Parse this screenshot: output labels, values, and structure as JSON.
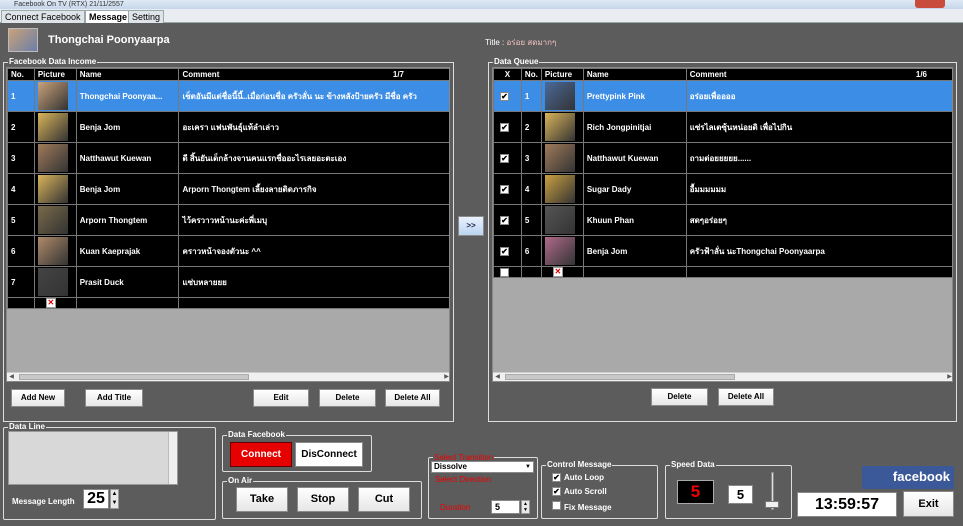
{
  "window": {
    "title": "Facebook On TV (RTX) 21/11/2557"
  },
  "tabs": [
    {
      "label": "Connect Facebook"
    },
    {
      "label": "Message"
    },
    {
      "label": "Setting"
    }
  ],
  "profile": {
    "name": "Thongchai Poonyaarpa"
  },
  "title_bar": {
    "label": "Title :",
    "value": "อร่อย สดมากๆ"
  },
  "income": {
    "legend": "Facebook Data Income",
    "headers": [
      "No.",
      "Picture",
      "Name",
      "Comment",
      "1/7"
    ],
    "rows": [
      {
        "no": "1",
        "name": "Thongchai Poonyaa...",
        "comment": "เซ็ตอันมีแต่ชื่อนี้นี้..เมื่อก่อนชื่อ ครัวลั่น นะ ข้างหลังป้ายครัว มีชื่อ ครัว",
        "selected": true
      },
      {
        "no": "2",
        "name": "Benja Jom",
        "comment": "อะเครา แฟนพันธุ์แท้ลำเล่าว"
      },
      {
        "no": "3",
        "name": "Natthawut Kuewan",
        "comment": "ดี สิ้นยันเด็กล้างจานคนแรกชื่ออะไรเลยอะตะเอง"
      },
      {
        "no": "4",
        "name": "Benja Jom",
        "comment": "Arporn Thongtem เลี้ยงลายติดภารกิจ"
      },
      {
        "no": "5",
        "name": "Arporn Thongtem",
        "comment": "ไว้ครวาวหน้านะค่ะพี่เมบุ"
      },
      {
        "no": "6",
        "name": "Kuan Kaeprajak",
        "comment": "คราวหน้าจองตัวนะ ^^"
      },
      {
        "no": "7",
        "name": "Prasit Duck",
        "comment": "แซ่บหลายยย"
      }
    ],
    "buttons": {
      "add_new": "Add New",
      "add_title": "Add Title",
      "edit": "Edit",
      "delete": "Delete",
      "delete_all": "Delete All"
    }
  },
  "transfer_button": ">>",
  "queue": {
    "legend": "Data Queue",
    "headers": [
      "X",
      "No.",
      "Picture",
      "Name",
      "Comment",
      "1/6"
    ],
    "rows": [
      {
        "no": "1",
        "name": "Prettypink Pink",
        "comment": "อร่อยเพื่ออออ",
        "checked": true,
        "selected": true
      },
      {
        "no": "2",
        "name": "Rich Jongpinitjai",
        "comment": "แซ่รไลเตซุ้นหน่อยดิ เพื่อไปกิน",
        "checked": true
      },
      {
        "no": "3",
        "name": "Natthawut Kuewan",
        "comment": "ถามต่อยยยยย......",
        "checked": true
      },
      {
        "no": "4",
        "name": "Sugar Dady",
        "comment": "อื้มมมมมม",
        "checked": true
      },
      {
        "no": "5",
        "name": "Khuun Phan",
        "comment": "สดๆอร่อยๆ",
        "checked": true
      },
      {
        "no": "6",
        "name": "Benja Jom",
        "comment": "ครัวฟ้าลั่น นะThongchai Poonyaarpa",
        "checked": true
      }
    ],
    "buttons": {
      "delete": "Delete",
      "delete_all": "Delete All"
    }
  },
  "data_line": {
    "legend": "Data Line",
    "message_length_label": "Message Length",
    "message_length_value": "25"
  },
  "data_facebook": {
    "legend": "Data Facebook",
    "connect": "Connect",
    "disconnect": "DisConnect"
  },
  "on_air": {
    "legend": "On Air",
    "take": "Take",
    "stop": "Stop",
    "cut": "Cut"
  },
  "transition": {
    "legend": "Select Transition",
    "value": "Dissolve",
    "direction_label": "Select Direction",
    "duration_label": "Duration",
    "duration_value": "5"
  },
  "control_message": {
    "legend": "Control Message",
    "auto_loop": "Auto Loop",
    "auto_scroll": "Auto Scroll",
    "fix_message": "Fix Message"
  },
  "speed_data": {
    "legend": "Speed Data",
    "display": "5",
    "value": "5"
  },
  "brand": {
    "logo": "facebook"
  },
  "clock": "13:59:57",
  "exit": "Exit",
  "colors": {
    "selected_row": "#3c8de6",
    "connect_red": "#e00000",
    "fb_blue": "#3b5998"
  }
}
